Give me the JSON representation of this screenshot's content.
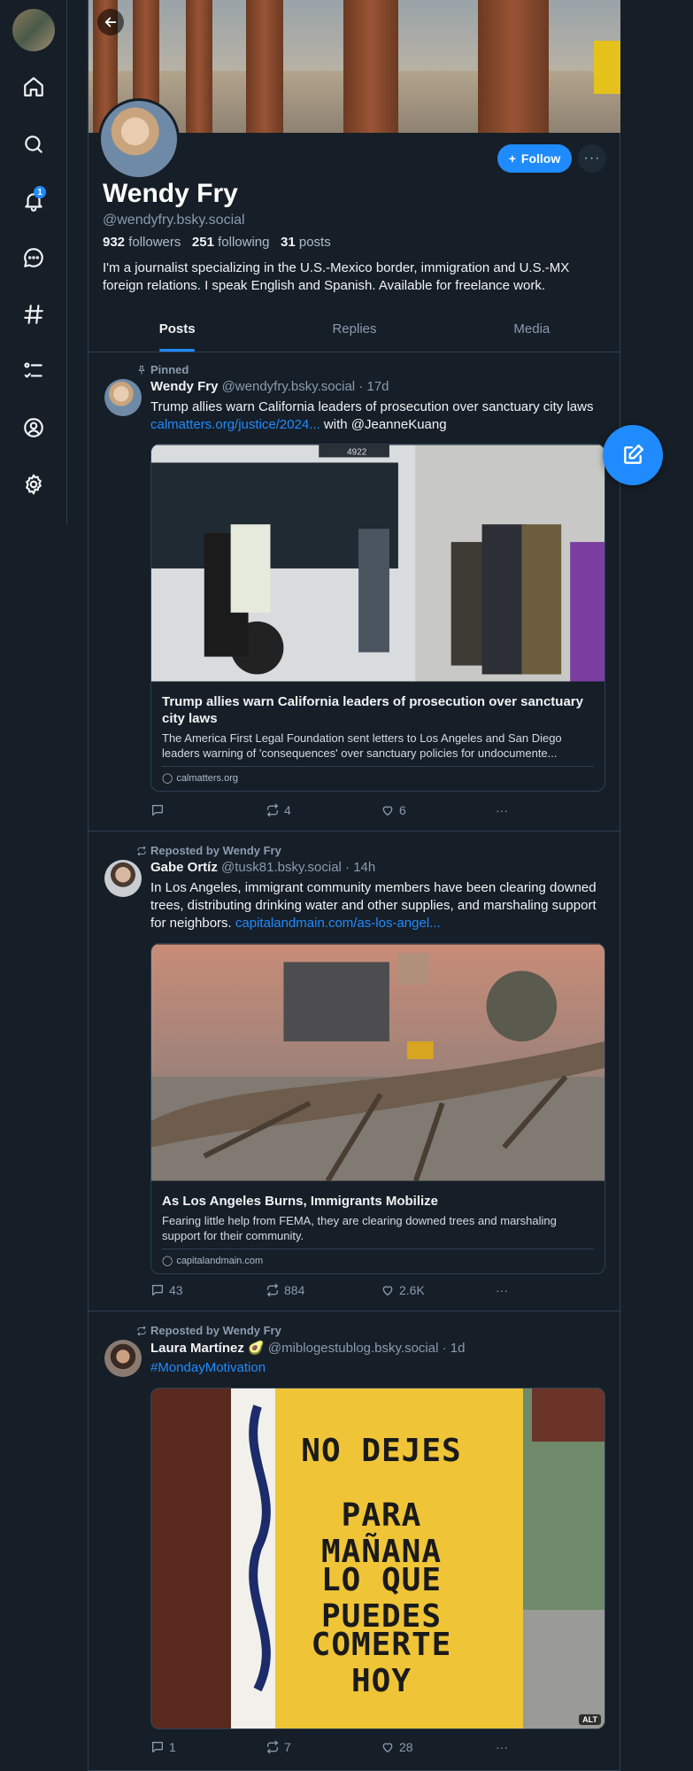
{
  "nav": {
    "notification_count": "1",
    "items": [
      "home-icon",
      "search-icon",
      "bell-icon",
      "chat-icon",
      "hashtag-icon",
      "list-icon",
      "profile-icon",
      "gear-icon"
    ]
  },
  "profile": {
    "name": "Wendy Fry",
    "handle": "@wendyfry.bsky.social",
    "followers_count": "932",
    "followers_label": "followers",
    "following_count": "251",
    "following_label": "following",
    "posts_count": "31",
    "posts_label": "posts",
    "bio": "I'm a journalist specializing in the U.S.-Mexico border, immigration and U.S.-MX foreign relations. I speak English and Spanish. Available for freelance work.",
    "follow_label": "Follow",
    "more_label": "···"
  },
  "tabs": [
    {
      "label": "Posts",
      "active": true
    },
    {
      "label": "Replies",
      "active": false
    },
    {
      "label": "Media",
      "active": false
    }
  ],
  "posts": [
    {
      "reason": "Pinned",
      "name": "Wendy Fry",
      "handle": "@wendyfry.bsky.social",
      "time": "· 17d",
      "text_pre": "Trump allies warn California leaders of prosecution over sanctuary city laws ",
      "text_link": "calmatters.org/justice/2024...",
      "text_post": " with @JeanneKuang",
      "card_title": "Trump allies warn California leaders of prosecution over sanctuary city laws",
      "card_desc": "The America First Legal Foundation sent letters to Los Angeles and San Diego leaders warning of 'consequences' over sanctuary policies for undocumente...",
      "card_domain": "calmatters.org",
      "replies": "",
      "reposts": "4",
      "likes": "6"
    },
    {
      "reason": "Reposted by Wendy Fry",
      "name": "Gabe Ortíz",
      "handle": "@tusk81.bsky.social",
      "time": "· 14h",
      "text_pre": "In Los Angeles, immigrant community members have been clearing downed trees, distributing drinking water and other supplies, and marshaling support for neighbors. ",
      "text_link": "capitalandmain.com/as-los-angel...",
      "text_post": "",
      "card_title": "As Los Angeles Burns, Immigrants Mobilize",
      "card_desc": "Fearing little help from FEMA, they are clearing downed trees and marshaling support for their community.",
      "card_domain": "capitalandmain.com",
      "replies": "43",
      "reposts": "884",
      "likes": "2.6K"
    },
    {
      "reason": "Reposted by Wendy Fry",
      "name": "Laura Martínez 🥑",
      "handle": "@miblogestublog.bsky.social",
      "time": "· 1d",
      "text_link": "#MondayMotivation",
      "sign_lines": [
        "NO DEJES",
        "PARA MAÑANA",
        "LO QUE PUEDES",
        "COMERTE HOY"
      ],
      "alt": "ALT",
      "replies": "1",
      "reposts": "7",
      "likes": "28"
    }
  ],
  "colors": {
    "accent": "#208bfe",
    "background": "#161e27",
    "border": "#2e4052"
  }
}
